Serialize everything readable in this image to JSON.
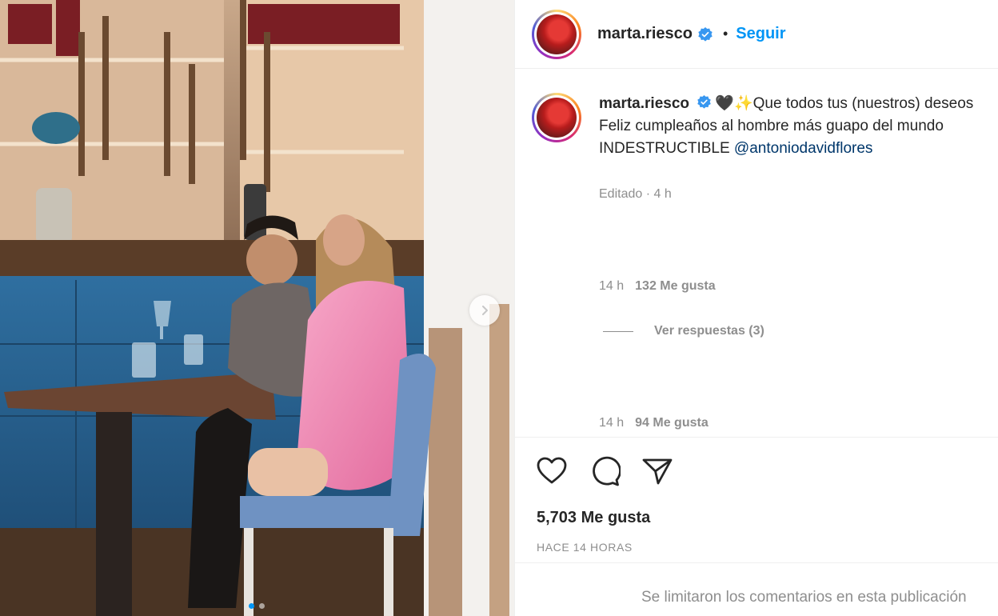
{
  "header": {
    "username": "marta.riesco",
    "separator": "•",
    "follow_label": "Seguir"
  },
  "caption": {
    "username": "marta.riesco",
    "emoji": "🖤✨",
    "line1": "Que todos tus (nuestros) deseos",
    "line2": "Feliz cumpleaños al hombre más guapo del mundo",
    "line3_prefix": "INDESTRUCTIBLE ",
    "mention": "@antoniodavidflores",
    "edited": "Editado · 4 h"
  },
  "replies": [
    {
      "time": "14 h",
      "likes": "132 Me gusta"
    },
    {
      "time": "14 h",
      "likes": "94 Me gusta"
    }
  ],
  "view_replies": "Ver respuestas (3)",
  "post": {
    "likes": "5,703 Me gusta",
    "time": "HACE 14 HORAS",
    "comments_limited": "Se limitaron los comentarios en esta publicación"
  },
  "carousel": {
    "slides": 2,
    "active": 1
  },
  "colors": {
    "accent": "#0095f6",
    "text": "#262626",
    "muted": "#8e8e8e",
    "mention": "#00376b"
  }
}
